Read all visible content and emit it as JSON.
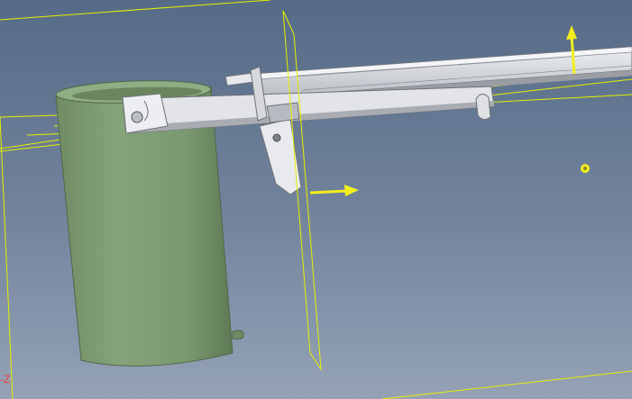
{
  "viewport": {
    "name": "CAD 3D viewport",
    "axis_indicator_label": "-Z"
  },
  "colors": {
    "background_top": "#566b87",
    "background_bottom": "#8c9ab0",
    "wireframe": "#e6f000",
    "cylinder": "#7e9c72",
    "cylinder_dark": "#5e7a55",
    "cylinder_top": "#8fae84",
    "metal_light": "#e4e6ea",
    "metal_mid": "#c3c6cc",
    "metal_dark": "#8d9097",
    "arrow": "#f2ee1a",
    "axis_label": "#ff3b3b"
  },
  "icons": {
    "arrow_up": "vertical-manipulator-arrow-icon",
    "arrow_right": "horizontal-manipulator-arrow-icon",
    "pivot": "pivot-point-icon"
  }
}
